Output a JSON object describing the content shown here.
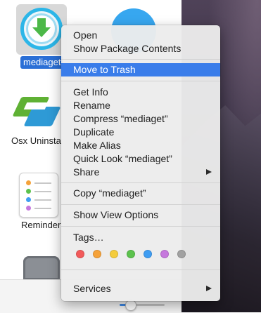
{
  "desktop_icons": {
    "selected_label": "mediaget",
    "osx_label": "Osx Uninsta",
    "reminders_label": "Reminder"
  },
  "context_menu": {
    "items": [
      {
        "label": "Open",
        "submenu": false
      },
      {
        "label": "Show Package Contents",
        "submenu": false
      },
      {
        "label": "Move to Trash",
        "submenu": false,
        "highlighted": true
      },
      {
        "label": "Get Info",
        "submenu": false
      },
      {
        "label": "Rename",
        "submenu": false
      },
      {
        "label": "Compress “mediaget”",
        "submenu": false
      },
      {
        "label": "Duplicate",
        "submenu": false
      },
      {
        "label": "Make Alias",
        "submenu": false
      },
      {
        "label": "Quick Look “mediaget”",
        "submenu": false
      },
      {
        "label": "Share",
        "submenu": true
      },
      {
        "label": "Copy “mediaget”",
        "submenu": false
      },
      {
        "label": "Show View Options",
        "submenu": false
      },
      {
        "label": "Tags…",
        "submenu": false
      },
      {
        "label": "Services",
        "submenu": true
      }
    ],
    "tag_colors": [
      {
        "name": "red",
        "color": "#f25a5a"
      },
      {
        "name": "orange",
        "color": "#f5a23a"
      },
      {
        "name": "yellow",
        "color": "#f4cc3c"
      },
      {
        "name": "green",
        "color": "#5cc24d"
      },
      {
        "name": "blue",
        "color": "#3f9df2"
      },
      {
        "name": "purple",
        "color": "#c678dd"
      },
      {
        "name": "gray",
        "color": "#a2a2a2"
      }
    ]
  },
  "accent_color": "#3a7dea"
}
